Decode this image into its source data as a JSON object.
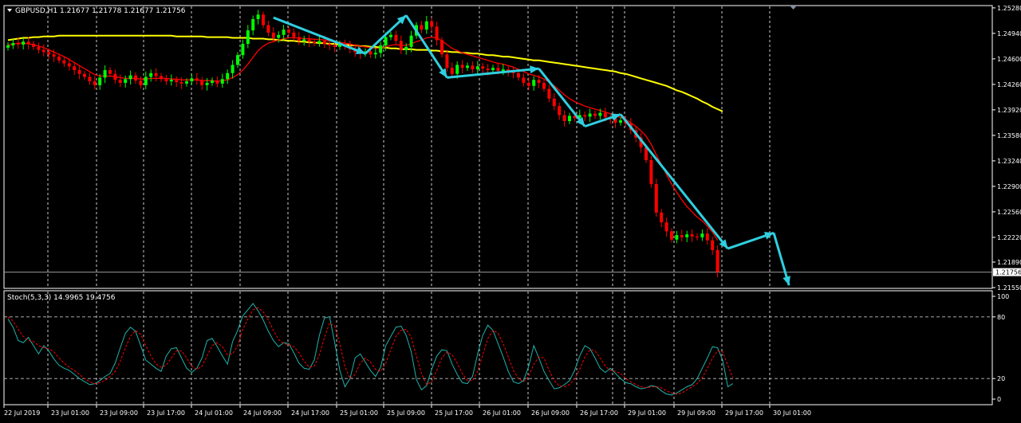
{
  "window": {
    "symbol_title": "GBPUSD,H1  1.21677 1.21778 1.21677 1.21756",
    "indicator_title": "Stoch(5,3,3) 14.9965 19.4756",
    "current_price_label": "1.21756"
  },
  "colors": {
    "background": "#000000",
    "bull_candle": "#00ff00",
    "bear_candle": "#ff0000",
    "ma_fast": "#ff0000",
    "ma_slow": "#ffff00",
    "wave_arrows": "#2fcfdf",
    "stoch_main": "#20b2aa",
    "stoch_signal": "#ff0000",
    "grid": "#ffffff"
  },
  "chart_data": [
    {
      "type": "candlestick",
      "symbol": "GBPUSD",
      "timeframe": "H1",
      "ylim": [
        1.2155,
        1.253
      ],
      "y_ticks": [
        "1.25280",
        "1.24940",
        "1.24600",
        "1.24260",
        "1.23920",
        "1.23580",
        "1.23240",
        "1.22900",
        "1.22560",
        "1.22220",
        "1.21890",
        "1.21550"
      ],
      "x_ticks": [
        "22 Jul 2019",
        "23 Jul 01:00",
        "23 Jul 09:00",
        "23 Jul 17:00",
        "24 Jul 01:00",
        "24 Jul 09:00",
        "24 Jul 17:00",
        "25 Jul 01:00",
        "25 Jul 09:00",
        "25 Jul 17:00",
        "26 Jul 01:00",
        "26 Jul 09:00",
        "26 Jul 17:00",
        "29 Jul 01:00",
        "29 Jul 09:00",
        "29 Jul 17:00",
        "30 Jul 01:00"
      ],
      "grid": "vertical dashed",
      "closes": [
        1.2478,
        1.2481,
        1.2479,
        1.2483,
        1.248,
        1.2476,
        1.2472,
        1.2469,
        1.2466,
        1.2463,
        1.2458,
        1.2454,
        1.245,
        1.2445,
        1.244,
        1.2436,
        1.243,
        1.2425,
        1.2435,
        1.2445,
        1.244,
        1.2432,
        1.2428,
        1.2433,
        1.2438,
        1.2431,
        1.2425,
        1.2436,
        1.2441,
        1.2437,
        1.2433,
        1.243,
        1.2432,
        1.2429,
        1.2427,
        1.243,
        1.2434,
        1.2431,
        1.2425,
        1.2428,
        1.2431,
        1.2427,
        1.2433,
        1.2441,
        1.2452,
        1.2465,
        1.248,
        1.2498,
        1.2513,
        1.2519,
        1.2505,
        1.2495,
        1.2488,
        1.2492,
        1.2499,
        1.2495,
        1.2489,
        1.2484,
        1.2486,
        1.2483,
        1.2481,
        1.2484,
        1.248,
        1.2478,
        1.2476,
        1.248,
        1.2477,
        1.2473,
        1.2469,
        1.2467,
        1.247,
        1.2466,
        1.2468,
        1.2478,
        1.2489,
        1.2492,
        1.2484,
        1.2472,
        1.2476,
        1.2491,
        1.2505,
        1.2499,
        1.251,
        1.2503,
        1.2485,
        1.2466,
        1.2448,
        1.244,
        1.2452,
        1.2448,
        1.2451,
        1.2446,
        1.245,
        1.2447,
        1.2445,
        1.2448,
        1.2444,
        1.2446,
        1.2443,
        1.2441,
        1.2435,
        1.2428,
        1.2424,
        1.2432,
        1.2428,
        1.242,
        1.2407,
        1.2397,
        1.2385,
        1.2377,
        1.2384,
        1.2381,
        1.2385,
        1.2383,
        1.2387,
        1.2384,
        1.2388,
        1.2382,
        1.238,
        1.2375,
        1.2378,
        1.2374,
        1.2365,
        1.2355,
        1.2342,
        1.2325,
        1.2293,
        1.2255,
        1.2242,
        1.223,
        1.2219,
        1.2225,
        1.2222,
        1.2226,
        1.2223,
        1.2222,
        1.2227,
        1.2218,
        1.2205,
        1.2176
      ],
      "series": [
        {
          "name": "",
          "kind": "moving average",
          "color": "#ff0000",
          "values": [
            1.2478,
            1.248,
            1.2481,
            1.2481,
            1.248,
            1.2479,
            1.2477,
            1.2475,
            1.2472,
            1.2469,
            1.2466,
            1.2463,
            1.2459,
            1.2455,
            1.2451,
            1.2447,
            1.2443,
            1.2439,
            1.2437,
            1.2437,
            1.2437,
            1.2436,
            1.2435,
            1.2434,
            1.2434,
            1.2434,
            1.2433,
            1.2433,
            1.2434,
            1.2434,
            1.2434,
            1.2434,
            1.2433,
            1.2433,
            1.2432,
            1.2432,
            1.2432,
            1.2432,
            1.2431,
            1.2431,
            1.2431,
            1.243,
            1.2431,
            1.2432,
            1.2435,
            1.2439,
            1.2445,
            1.2453,
            1.2462,
            1.2471,
            1.2477,
            1.2481,
            1.2483,
            1.2485,
            1.2487,
            1.2488,
            1.2488,
            1.2488,
            1.2487,
            1.2487,
            1.2486,
            1.2486,
            1.2485,
            1.2484,
            1.2483,
            1.2482,
            1.2481,
            1.248,
            1.2478,
            1.2477,
            1.2476,
            1.2475,
            1.2474,
            1.2474,
            1.2476,
            1.2478,
            1.2479,
            1.2478,
            1.2478,
            1.248,
            1.2483,
            1.2485,
            1.2488,
            1.2489,
            1.2488,
            1.2484,
            1.2479,
            1.2474,
            1.2471,
            1.2468,
            1.2466,
            1.2464,
            1.2462,
            1.246,
            1.2458,
            1.2456,
            1.2454,
            1.2453,
            1.2451,
            1.2449,
            1.2446,
            1.2443,
            1.244,
            1.2438,
            1.2436,
            1.2433,
            1.2429,
            1.2424,
            1.2418,
            1.2412,
            1.2407,
            1.2403,
            1.24,
            1.2397,
            1.2395,
            1.2393,
            1.2391,
            1.2389,
            1.2387,
            1.2384,
            1.2382,
            1.2379,
            1.2375,
            1.237,
            1.2364,
            1.2357,
            1.2346,
            1.2332,
            1.2319,
            1.2306,
            1.2293,
            1.2282,
            1.2272,
            1.2263,
            1.2256,
            1.2249,
            1.2244,
            1.2237,
            1.2229,
            1.2218
          ]
        },
        {
          "name": "",
          "kind": "moving average",
          "color": "#ffff00",
          "values": [
            1.2485,
            1.2486,
            1.2487,
            1.2488,
            1.2488,
            1.2489,
            1.2489,
            1.249,
            1.249,
            1.249,
            1.2491,
            1.2491,
            1.2491,
            1.2491,
            1.2491,
            1.2491,
            1.2491,
            1.2491,
            1.2491,
            1.2491,
            1.2491,
            1.2491,
            1.2491,
            1.2491,
            1.2491,
            1.2491,
            1.2491,
            1.2491,
            1.2491,
            1.2491,
            1.2491,
            1.2491,
            1.2491,
            1.249,
            1.249,
            1.249,
            1.249,
            1.249,
            1.249,
            1.2489,
            1.2489,
            1.2489,
            1.2489,
            1.2489,
            1.2488,
            1.2488,
            1.2488,
            1.2488,
            1.2487,
            1.2487,
            1.2487,
            1.2486,
            1.2486,
            1.2485,
            1.2485,
            1.2484,
            1.2484,
            1.2483,
            1.2483,
            1.2482,
            1.2482,
            1.2481,
            1.2481,
            1.248,
            1.248,
            1.2479,
            1.2479,
            1.2478,
            1.2478,
            1.2477,
            1.2477,
            1.2476,
            1.2476,
            1.2475,
            1.2475,
            1.2474,
            1.2474,
            1.2473,
            1.2473,
            1.2473,
            1.2472,
            1.2472,
            1.2472,
            1.2471,
            1.2471,
            1.247,
            1.247,
            1.2469,
            1.2469,
            1.2468,
            1.2468,
            1.2467,
            1.2467,
            1.2466,
            1.2465,
            1.2465,
            1.2464,
            1.2463,
            1.2463,
            1.2462,
            1.2461,
            1.246,
            1.2459,
            1.2458,
            1.2458,
            1.2457,
            1.2456,
            1.2455,
            1.2454,
            1.2453,
            1.2452,
            1.2451,
            1.245,
            1.2449,
            1.2448,
            1.2447,
            1.2446,
            1.2445,
            1.2444,
            1.2443,
            1.2441,
            1.244,
            1.2438,
            1.2436,
            1.2434,
            1.2432,
            1.243,
            1.2428,
            1.2426,
            1.2424,
            1.2421,
            1.2418,
            1.2416,
            1.2413,
            1.241,
            1.2407,
            1.2403,
            1.24,
            1.2396,
            1.2393,
            1.239
          ]
        }
      ],
      "wave_arrows": [
        {
          "from": [
            52,
            1.2515
          ],
          "to": [
            70,
            1.2467
          ]
        },
        {
          "from": [
            70,
            1.2467
          ],
          "to": [
            78,
            1.2518
          ]
        },
        {
          "from": [
            78,
            1.2518
          ],
          "to": [
            86,
            1.2435
          ]
        },
        {
          "from": [
            86,
            1.2435
          ],
          "to": [
            104,
            1.2447
          ]
        },
        {
          "from": [
            104,
            1.2447
          ],
          "to": [
            113,
            1.237
          ]
        },
        {
          "from": [
            113,
            1.237
          ],
          "to": [
            120,
            1.2386
          ]
        },
        {
          "from": [
            120,
            1.2386
          ],
          "to": [
            141,
            1.2207
          ]
        },
        {
          "from": [
            141,
            1.2207
          ],
          "to": [
            150,
            1.2228
          ]
        },
        {
          "from": [
            150,
            1.2228
          ],
          "to": [
            153,
            1.2158
          ]
        }
      ]
    },
    {
      "type": "line",
      "indicator": "Stochastic Oscillator",
      "ylim": [
        0,
        100
      ],
      "y_ticks": [
        "100",
        "80",
        "20",
        "0"
      ],
      "levels": [
        80,
        20
      ],
      "series": [
        {
          "name": "",
          "color": "#20b2aa",
          "values": [
            78,
            70,
            57,
            55,
            60,
            52,
            44,
            52,
            47,
            39,
            33,
            30,
            28,
            24,
            20,
            17,
            14,
            15,
            18,
            22,
            25,
            35,
            50,
            64,
            70,
            66,
            52,
            38,
            34,
            30,
            27,
            42,
            49,
            50,
            40,
            30,
            26,
            30,
            40,
            57,
            59,
            51,
            42,
            34,
            56,
            67,
            81,
            87,
            93,
            86,
            77,
            66,
            57,
            51,
            55,
            54,
            45,
            35,
            30,
            29,
            38,
            62,
            79,
            80,
            55,
            28,
            12,
            20,
            40,
            44,
            36,
            28,
            22,
            31,
            52,
            61,
            70,
            71,
            62,
            46,
            19,
            9,
            13,
            29,
            42,
            48,
            47,
            34,
            24,
            16,
            15,
            22,
            44,
            62,
            72,
            67,
            54,
            41,
            27,
            17,
            15,
            18,
            32,
            52,
            40,
            27,
            18,
            10,
            11,
            14,
            18,
            28,
            42,
            52,
            49,
            40,
            30,
            26,
            30,
            25,
            20,
            16,
            15,
            12,
            10,
            11,
            13,
            12,
            8,
            5,
            4,
            6,
            9,
            12,
            14,
            20,
            30,
            40,
            51,
            50,
            38,
            12,
            15
          ]
        },
        {
          "name": "",
          "color": "#ff0000",
          "values": [
            80,
            76,
            68,
            61,
            57,
            56,
            52,
            50,
            49,
            46,
            40,
            35,
            31,
            28,
            24,
            20,
            17,
            15,
            16,
            18,
            22,
            27,
            37,
            50,
            61,
            67,
            63,
            52,
            42,
            34,
            31,
            33,
            40,
            47,
            47,
            40,
            32,
            29,
            32,
            42,
            52,
            55,
            51,
            43,
            44,
            52,
            68,
            78,
            87,
            89,
            85,
            77,
            67,
            58,
            54,
            53,
            51,
            45,
            37,
            31,
            32,
            43,
            60,
            74,
            71,
            54,
            32,
            20,
            24,
            35,
            40,
            36,
            29,
            27,
            35,
            48,
            61,
            67,
            68,
            60,
            42,
            25,
            14,
            17,
            28,
            40,
            46,
            43,
            35,
            25,
            18,
            18,
            27,
            43,
            59,
            67,
            64,
            54,
            41,
            28,
            20,
            17,
            22,
            34,
            41,
            40,
            28,
            18,
            13,
            12,
            14,
            20,
            29,
            41,
            48,
            47,
            40,
            32,
            28,
            27,
            25,
            20,
            17,
            14,
            12,
            11,
            12,
            12,
            11,
            8,
            6,
            5,
            6,
            9,
            12,
            15,
            21,
            30,
            40,
            47,
            46,
            33,
            21
          ]
        }
      ]
    }
  ]
}
